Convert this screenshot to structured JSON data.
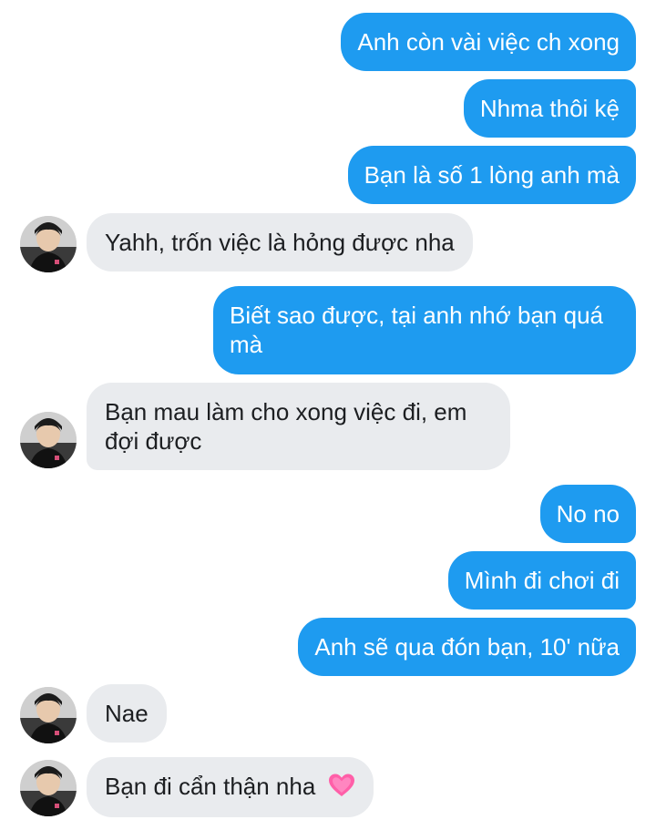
{
  "messages": [
    {
      "side": "out",
      "text": "Anh còn vài việc ch xong"
    },
    {
      "side": "out",
      "text": "Nhma thôi kệ"
    },
    {
      "side": "out",
      "text": "Bạn là số 1 lòng anh mà"
    },
    {
      "side": "in",
      "text": "Yahh, trốn việc là hỏng được nha"
    },
    {
      "side": "out",
      "text": "Biết sao được, tại anh nhớ bạn quá mà"
    },
    {
      "side": "in",
      "text": "Bạn mau làm cho xong việc đi, em đợi được"
    },
    {
      "side": "out",
      "text": "No no"
    },
    {
      "side": "out",
      "text": "Mình đi chơi đi"
    },
    {
      "side": "out",
      "text": "Anh sẽ qua đón bạn, 10' nữa"
    },
    {
      "side": "in",
      "text": "Nae"
    },
    {
      "side": "in",
      "text": "Bạn đi cẩn thận nha",
      "emoji": "pink-heart-icon"
    }
  ],
  "colors": {
    "outgoing_bubble": "#1e9bf0",
    "incoming_bubble": "#e9ebee",
    "outgoing_text": "#ffffff",
    "incoming_text": "#1c1e21",
    "heart": "#ff5fa8"
  }
}
